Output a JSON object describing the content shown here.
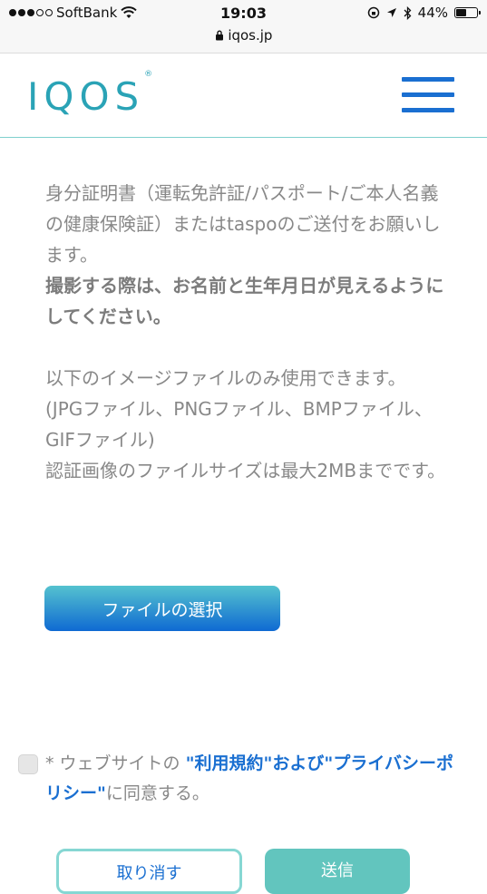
{
  "status_bar": {
    "carrier": "SoftBank",
    "time": "19:03",
    "battery": "44%",
    "battery_level": 0.44,
    "url": "iqos.jp"
  },
  "header": {
    "logo": "IQOS",
    "logo_mark": "®"
  },
  "content": {
    "paragraph1": "身分証明書（運転免許証/パスポート/ご本人名義の健康保険証）またはtaspoのご送付をお願いします。",
    "paragraph1_bold": "撮影する際は、お名前と生年月日が見えるようにしてください。",
    "paragraph2": "以下のイメージファイルのみ使用できます。",
    "paragraph3": "(JPGファイル、PNGファイル、BMPファイル、GIFファイル)",
    "paragraph4": "認証画像のファイルサイズは最大2MBまでです。"
  },
  "file_button": {
    "label": "ファイルの選択"
  },
  "agreement": {
    "prefix": "* ウェブサイトの ",
    "terms_link": "\"利用規約\"",
    "and_text": "および",
    "privacy_link": "\"プライバシーポリシー\"",
    "suffix": "に同意する。",
    "checked": false
  },
  "bottom_buttons": {
    "cancel_label": "取り消す",
    "send_label": "送信"
  }
}
